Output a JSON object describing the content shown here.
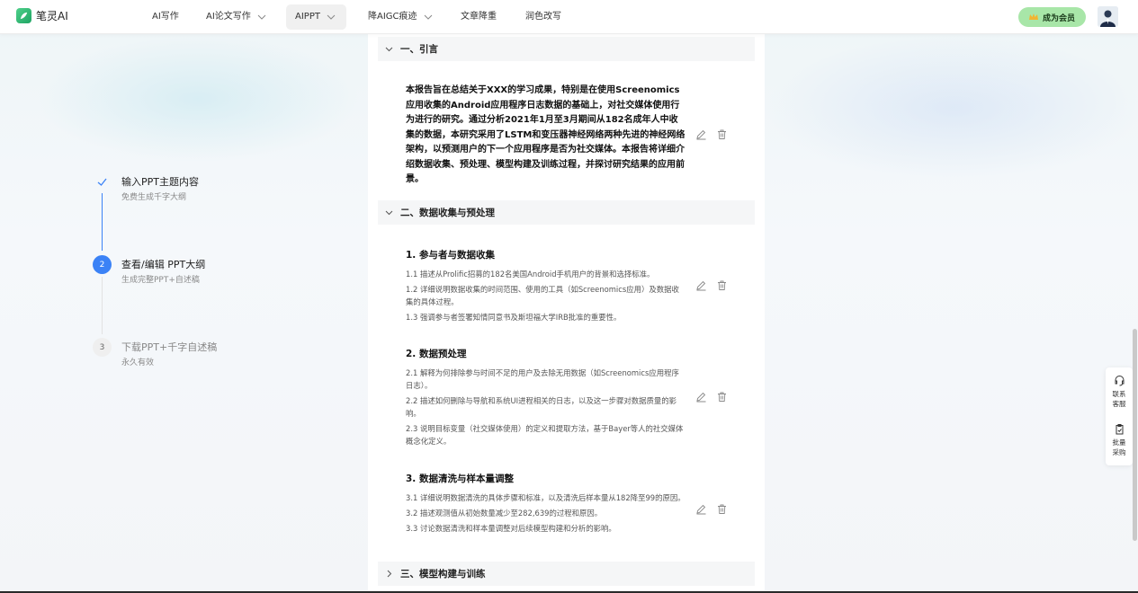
{
  "app": {
    "name": "笔灵AI"
  },
  "nav": {
    "items": [
      {
        "label": "AI写作",
        "has_dropdown": false,
        "active": false
      },
      {
        "label": "AI论文写作",
        "has_dropdown": true,
        "active": false
      },
      {
        "label": "AIPPT",
        "has_dropdown": true,
        "active": true
      },
      {
        "label": "降AIGC痕迹",
        "has_dropdown": true,
        "active": false
      },
      {
        "label": "文章降重",
        "has_dropdown": false,
        "active": false
      },
      {
        "label": "润色改写",
        "has_dropdown": false,
        "active": false
      }
    ],
    "member_button": "成为会员"
  },
  "steps": [
    {
      "index": "✓",
      "title": "输入PPT主题内容",
      "subtitle": "免费生成千字大纲",
      "state": "done"
    },
    {
      "index": "2",
      "title": "查看/编辑 PPT大纲",
      "subtitle": "生成完整PPT+自述稿",
      "state": "current"
    },
    {
      "index": "3",
      "title": "下载PPT+千字自述稿",
      "subtitle": "永久有效",
      "state": "pending"
    }
  ],
  "outline": {
    "sections": [
      {
        "title": "一、引言",
        "expanded": true,
        "intro": "本报告旨在总结关于XXX的学习成果，特别是在使用Screenomics应用收集的Android应用程序日志数据的基础上，对社交媒体使用行为进行的研究。通过分析2021年1月至3月期间从182名成年人中收集的数据，本研究采用了LSTM和变压器神经网络两种先进的神经网络架构，以预测用户的下一个应用程序是否为社交媒体。本报告将详细介绍数据收集、预处理、模型构建及训练过程，并探讨研究结果的应用前景。"
      },
      {
        "title": "二、数据收集与预处理",
        "expanded": true,
        "subsections": [
          {
            "title": "1. 参与者与数据收集",
            "items": [
              "1.1 描述从Prolific招募的182名美国Android手机用户的背景和选择标准。",
              "1.2 详细说明数据收集的时间范围、使用的工具（如Screenomics应用）及数据收集的具体过程。",
              "1.3 强调参与者签署知情同意书及斯坦福大学IRB批准的重要性。"
            ]
          },
          {
            "title": "2. 数据预处理",
            "items": [
              "2.1 解释为何排除参与时间不足的用户及去除无用数据（如Screenomics应用程序日志）。",
              "2.2 描述如何删除与导航和系统UI进程相关的日志，以及这一步骤对数据质量的影响。",
              "2.3 说明目标变量（社交媒体使用）的定义和提取方法，基于Bayer等人的社交媒体概念化定义。"
            ]
          },
          {
            "title": "3. 数据清洗与样本量调整",
            "items": [
              "3.1 详细说明数据清洗的具体步骤和标准，以及清洗后样本量从182降至99的原因。",
              "3.2 描述观测值从初始数量减少至282,639的过程和原因。",
              "3.3 讨论数据清洗和样本量调整对后续模型构建和分析的影响。"
            ]
          }
        ]
      },
      {
        "title": "三、模型构建与训练",
        "expanded": false
      }
    ]
  },
  "float_panel": {
    "contact_line1": "联系",
    "contact_line2": "客服",
    "bulk_line1": "批量",
    "bulk_line2": "采购"
  },
  "colors": {
    "accent_blue": "#3b82f6",
    "member_green": "#a8e6a8",
    "logo_green": "#1fa463",
    "section_bg": "#f5f6f7"
  },
  "icons": [
    "logo-icon",
    "chevron-down-icon",
    "crown-icon",
    "check-icon",
    "chevron-right-icon",
    "edit-icon",
    "delete-icon",
    "headset-icon",
    "clipboard-icon"
  ]
}
